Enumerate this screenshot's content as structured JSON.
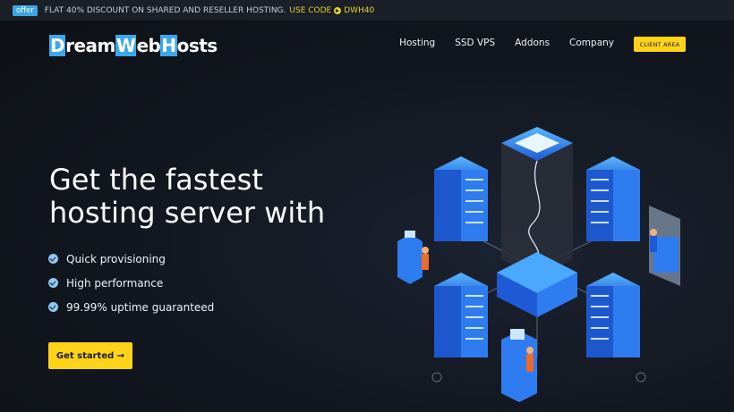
{
  "topbar": {
    "badge": "offer",
    "message": "FLAT 40% DISCOUNT ON SHARED AND RESELLER HOSTING.",
    "use_code": "USE CODE",
    "code": "DWH40"
  },
  "logo": {
    "parts": [
      "D",
      "ream",
      "W",
      "eb ",
      "H",
      "osts"
    ]
  },
  "nav": {
    "items": [
      "Hosting",
      "SSD VPS",
      "Addons",
      "Company"
    ],
    "client_area": "CLIENT AREA"
  },
  "hero": {
    "headline_line1": "Get the fastest",
    "headline_line2": "hosting server with",
    "features": [
      "Quick provisioning",
      "High performance",
      "99.99% uptime guaranteed"
    ],
    "cta": "Get started →"
  },
  "colors": {
    "accent_yellow": "#ffd31a",
    "accent_blue": "#3aa8ea",
    "background": "#12161e"
  }
}
